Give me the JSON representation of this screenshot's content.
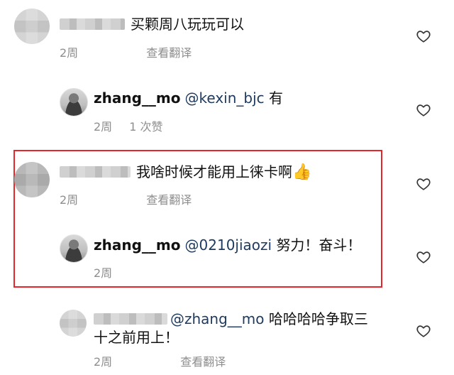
{
  "comments": [
    {
      "user_blurred": true,
      "text": "买颗周八玩玩可以",
      "time": "2周",
      "action": "查看翻译"
    },
    {
      "user": "zhang__mo",
      "mention": "@kexin_bjc",
      "text": "有",
      "time": "2周",
      "likes": "1 次赞"
    },
    {
      "user_blurred": true,
      "text": "我啥时候才能用上徕卡啊",
      "emoji": "👍",
      "time": "2周",
      "action": "查看翻译"
    },
    {
      "user": "zhang__mo",
      "mention": "@0210jiaozi",
      "text": "努力！奋斗！",
      "time": "2周"
    },
    {
      "user_blurred": true,
      "mention": "@zhang__mo",
      "text_line1": "哈哈哈哈争取三",
      "text_line2": "十之前用上！",
      "time": "2周",
      "action": "查看翻译"
    }
  ],
  "icons": {
    "like": "heart-outline-icon"
  },
  "colors": {
    "highlight": "#e5262b",
    "mention": "#1e3a5f",
    "meta": "#8e8e8e"
  }
}
